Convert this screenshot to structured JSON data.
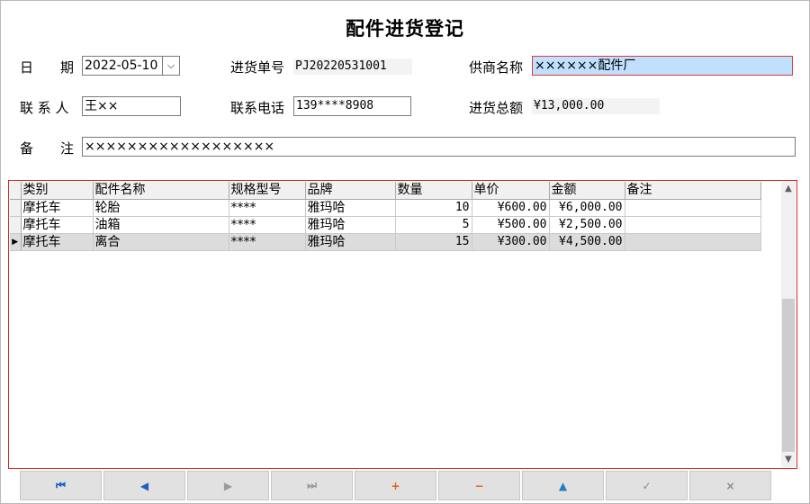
{
  "title": "配件进货登记",
  "form": {
    "date_label": "日　　期",
    "date_value": "2022-05-10",
    "order_no_label": "进货单号",
    "order_no_value": "PJ20220531001",
    "supplier_label": "供商名称",
    "supplier_value": "××××××配件厂",
    "contact_label": "联 系 人",
    "contact_value": "王××",
    "phone_label": "联系电话",
    "phone_value": "139****8908",
    "total_label": "进货总额",
    "total_value": "¥13,000.00",
    "remark_label": "备　　注",
    "remark_value": "××××××××××××××××××"
  },
  "table": {
    "columns": [
      "类别",
      "配件名称",
      "规格型号",
      "品牌",
      "数量",
      "单价",
      "金额",
      "备注"
    ],
    "rows": [
      [
        "摩托车",
        "轮胎",
        "****",
        "雅玛哈",
        "10",
        "¥600.00",
        "¥6,000.00",
        ""
      ],
      [
        "摩托车",
        "油箱",
        "****",
        "雅玛哈",
        "5",
        "¥500.00",
        "¥2,500.00",
        ""
      ],
      [
        "摩托车",
        "离合",
        "****",
        "雅玛哈",
        "15",
        "¥300.00",
        "¥4,500.00",
        ""
      ]
    ],
    "selected_row": 2
  },
  "nav": [
    {
      "name": "first-record-icon",
      "glyph": "⏮",
      "color": "#1f5fbf"
    },
    {
      "name": "previous-record-icon",
      "glyph": "◀",
      "color": "#1f5fbf"
    },
    {
      "name": "next-record-icon",
      "glyph": "▶",
      "color": "#9a9a9a"
    },
    {
      "name": "last-record-icon",
      "glyph": "⏭",
      "color": "#9a9a9a"
    },
    {
      "name": "add-record-icon",
      "glyph": "+",
      "color": "#e0601a"
    },
    {
      "name": "delete-record-icon",
      "glyph": "−",
      "color": "#e0601a"
    },
    {
      "name": "edit-record-icon",
      "glyph": "▲",
      "color": "#1f7fbf"
    },
    {
      "name": "post-record-icon",
      "glyph": "✓",
      "color": "#8a8a8a"
    },
    {
      "name": "cancel-record-icon",
      "glyph": "×",
      "color": "#8a8a8a"
    }
  ]
}
